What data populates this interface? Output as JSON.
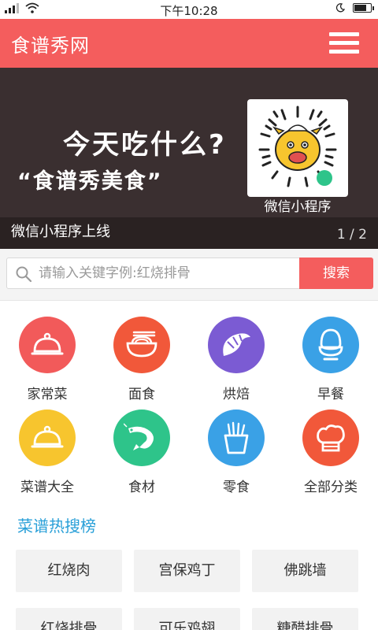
{
  "status_bar": {
    "time": "下午10:28",
    "signal_icon": "signal-icon",
    "wifi_icon": "wifi-icon",
    "moon_icon": "moon-icon",
    "battery_icon": "battery-icon"
  },
  "app_bar": {
    "title": "食谱秀网",
    "menu_icon": "hamburger-menu-icon",
    "color": "#f45d5d"
  },
  "banner": {
    "headline": "今天吃什么?",
    "subline": "“食谱秀美食”",
    "qr_label": "微信小程序",
    "caption": "微信小程序上线",
    "pager": "1 / 2"
  },
  "search": {
    "placeholder": "请输入关键字例:红烧排骨",
    "button_label": "搜索"
  },
  "categories": [
    {
      "label": "家常菜",
      "icon": "cloche-icon",
      "color": "#f25a5a"
    },
    {
      "label": "面食",
      "icon": "noodle-bowl-icon",
      "color": "#f1583a"
    },
    {
      "label": "烘焙",
      "icon": "croissant-icon",
      "color": "#7b5bd3"
    },
    {
      "label": "早餐",
      "icon": "egg-cup-icon",
      "color": "#3aa1e6"
    },
    {
      "label": "菜谱大全",
      "icon": "cloche-icon",
      "color": "#f7c52e"
    },
    {
      "label": "食材",
      "icon": "shrimp-icon",
      "color": "#2ec48a"
    },
    {
      "label": "零食",
      "icon": "fries-icon",
      "color": "#3aa1e6"
    },
    {
      "label": "全部分类",
      "icon": "chef-hat-icon",
      "color": "#f1583a"
    }
  ],
  "hot": {
    "title": "菜谱热搜榜",
    "tags": [
      "红烧肉",
      "宫保鸡丁",
      "佛跳墙",
      "红烧排骨",
      "可乐鸡翅",
      "糖醋排骨"
    ]
  }
}
